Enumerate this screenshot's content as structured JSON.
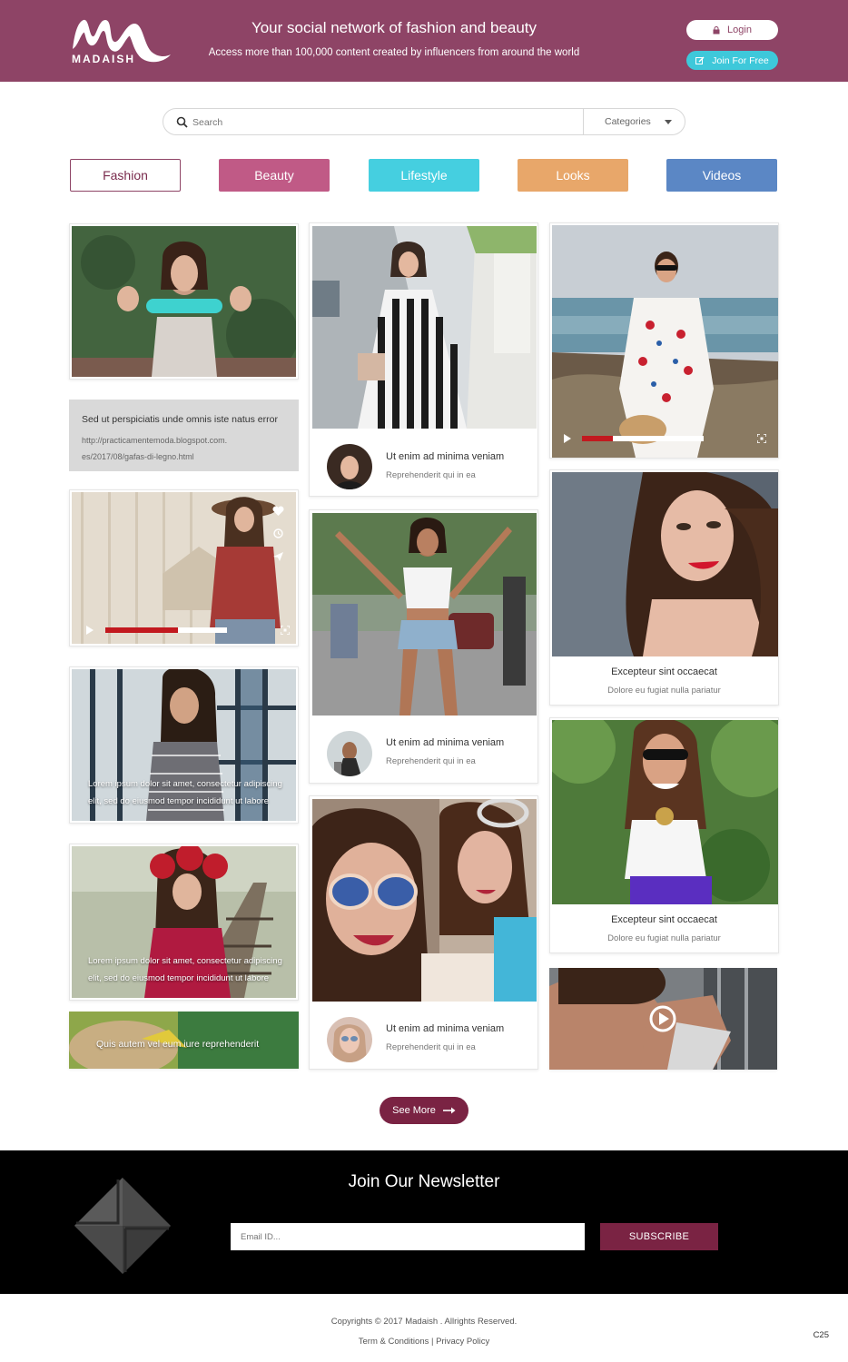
{
  "header": {
    "logo_text": "MADAISH",
    "tagline": "Your social network of fashion and beauty",
    "subtagline": "Access more than 100,000 content created by influencers from around the world",
    "login_label": "Login",
    "join_label": "Join For Free"
  },
  "search": {
    "placeholder": "Search",
    "categories_label": "Categories"
  },
  "categories": [
    {
      "label": "Fashion",
      "color": "#ffffff"
    },
    {
      "label": "Beauty",
      "color": "#c05a86"
    },
    {
      "label": "Lifestyle",
      "color": "#45cfe0"
    },
    {
      "label": "Looks",
      "color": "#e8a76a"
    },
    {
      "label": "Videos",
      "color": "#5b87c5"
    }
  ],
  "feed": {
    "col1": {
      "text_card_title": "Sed ut perspiciatis unde omnis iste natus error",
      "text_card_link_1": "http://practicamentemoda.blogspot.com.",
      "text_card_link_2": "es/2017/08/gafas-di-legno.html",
      "overlay_1_line1": "Lorem ipsum dolor sit amet, consectetur adipiscing",
      "overlay_1_line2": "elit, sed do eiusmod tempor incididunt ut labore",
      "overlay_2_line1": "Lorem ipsum dolor sit amet, consectetur adipiscing",
      "overlay_2_line2": "elit, sed do eiusmod tempor incididunt ut labore",
      "banner_text": "Quis autem vel eum iure reprehenderit"
    },
    "col2": [
      {
        "title": "Ut enim ad minima veniam",
        "sub": "Reprehenderit qui in ea"
      },
      {
        "title": "Ut enim ad minima veniam",
        "sub": "Reprehenderit qui in ea"
      },
      {
        "title": "Ut enim ad minima veniam",
        "sub": "Reprehenderit qui in ea"
      }
    ],
    "col3": [
      {
        "title": "Excepteur sint occaecat",
        "sub": "Dolore eu fugiat nulla pariatur"
      },
      {
        "title": "Excepteur sint occaecat",
        "sub": "Dolore eu fugiat nulla pariatur"
      }
    ],
    "video_1_progress": 0.6,
    "video_2_progress": 0.25
  },
  "see_more_label": "See More",
  "newsletter": {
    "title": "Join Our Newsletter",
    "email_placeholder": "Email ID...",
    "subscribe_label": "SUBSCRIBE"
  },
  "footer": {
    "copyright": "Copyrights © 2017 Madaish . Allrights Reserved.",
    "links": "Term & Conditions  |  Privacy Policy",
    "code": "C25"
  },
  "colors": {
    "brand": "#8e4466",
    "accent_dark": "#7a2343",
    "progress_red": "#c2191f"
  }
}
